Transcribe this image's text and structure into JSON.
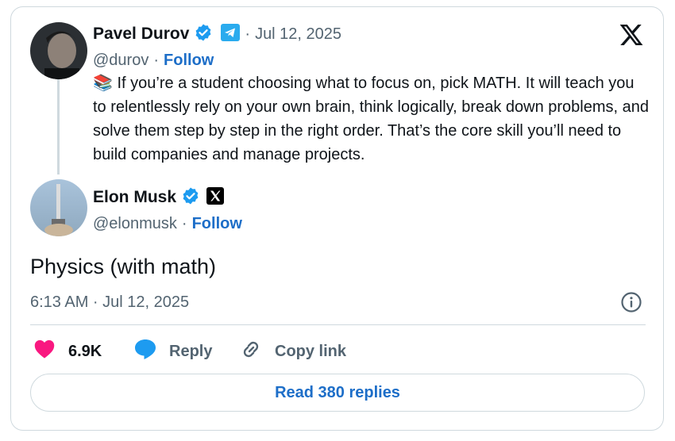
{
  "quoted": {
    "name": "Pavel Durov",
    "handle": "@durov",
    "date": "Jul 12, 2025",
    "follow_label": "Follow",
    "emoji": "📚",
    "text": "If you’re a student choosing what to focus on, pick MATH. It will teach you to relentlessly rely on your own brain, think logically, break down problems, and solve them step by step in the right order. That’s the core skill you’ll need to build companies and manage projects."
  },
  "author": {
    "name": "Elon Musk",
    "handle": "@elonmusk",
    "follow_label": "Follow"
  },
  "tweet": {
    "text": "Physics (with math)",
    "timestamp": "6:13 AM · Jul 12, 2025"
  },
  "actions": {
    "likes": "6.9K",
    "reply_label": "Reply",
    "copy_link_label": "Copy link"
  },
  "read_replies_label": "Read 380 replies",
  "colors": {
    "link_blue": "#1d6ec8",
    "verified_blue": "#1d9bf0",
    "like_pink": "#f91880",
    "telegram_blue": "#2aabee"
  },
  "icons": [
    "x-logo-icon",
    "verified-badge-icon",
    "telegram-icon",
    "info-icon",
    "heart-icon",
    "reply-bubble-icon",
    "link-icon"
  ]
}
